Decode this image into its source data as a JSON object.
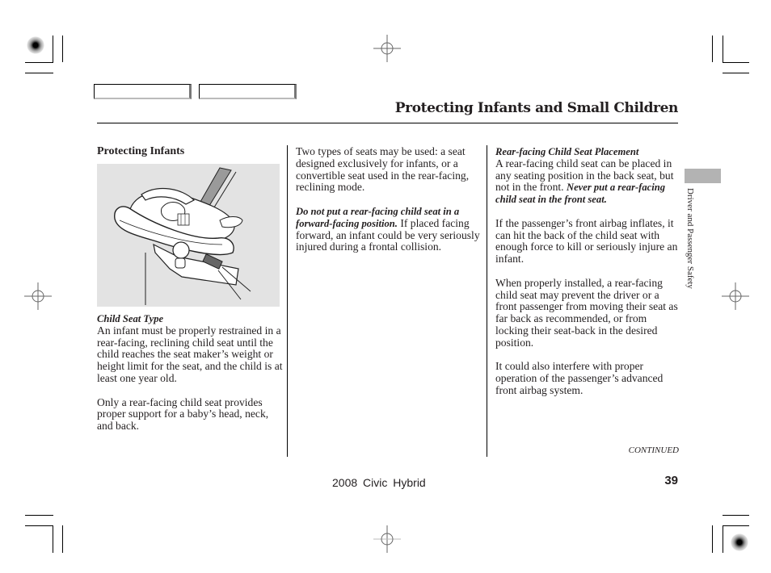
{
  "page": {
    "title": "Protecting Infants and Small Children",
    "section_tab": "Driver and Passenger Safety",
    "continued_label": "CONTINUED",
    "footer_model": "2008  Civic  Hybrid",
    "page_number": "39"
  },
  "nav_tabs": [
    {
      "label": ""
    },
    {
      "label": ""
    }
  ],
  "column1": {
    "heading": "Protecting Infants",
    "figure_alt": "Rear-facing infant child seat illustration",
    "subheading": "Child Seat Type",
    "paragraphs": [
      "An infant must be properly restrained in a rear-facing, reclining child seat until the child reaches the seat maker’s weight or height limit for the seat, and the child is at least one year old.",
      "Only a rear-facing child seat provides proper support for a baby’s head, neck, and back."
    ]
  },
  "column2": {
    "paragraph1": "Two types of seats may be used: a seat designed exclusively for infants, or a convertible seat used in the rear-facing, reclining mode.",
    "warning_bold": "Do not put a rear-facing child seat in a forward-facing position.",
    "warning_rest": " If placed facing forward, an infant could be very seriously injured during a frontal collision."
  },
  "column3": {
    "subheading": "Rear-facing Child Seat Placement",
    "p1_text": "A rear-facing child seat can be placed in any seating position in the back seat, but not in the front. ",
    "p1_bold": "Never put a rear-facing child seat in the front seat.",
    "paragraphs": [
      "If the passenger’s front airbag inflates, it can hit the back of the child seat with enough force to kill or seriously injure an infant.",
      "When properly installed, a rear-facing child seat may prevent the driver or a front passenger from moving their seat as far back as recommended, or from locking their seat-back in the desired position.",
      "It could also interfere with proper operation of the passenger’s advanced front airbag system."
    ]
  },
  "colors": {
    "text": "#231f20",
    "figure_bg": "#e3e3e3",
    "side_tab": "#b3b3b3"
  }
}
